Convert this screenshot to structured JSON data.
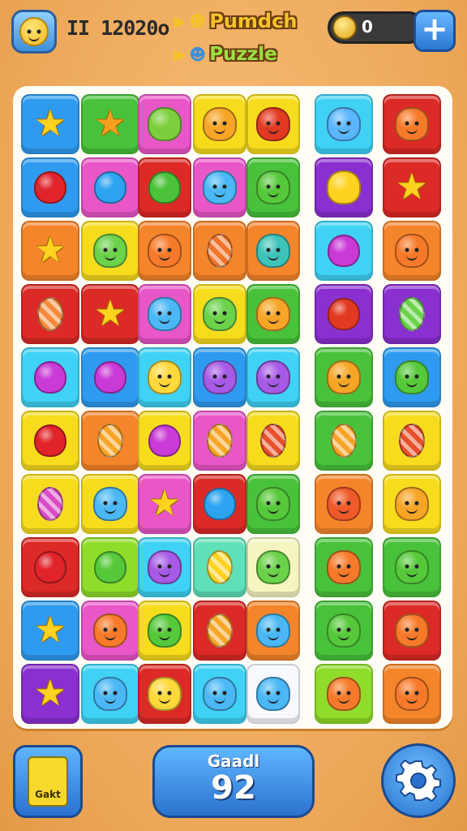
{
  "header": {
    "score": "II 12020o",
    "title_line1": "Pumdch",
    "title_line2": "Puzzle",
    "coins": "0",
    "add_label": "+"
  },
  "footer": {
    "bag_label": "Gakt",
    "goal_label": "Gaadl",
    "goal_value": "92"
  },
  "board": {
    "columns": 7,
    "rows": [
      [
        [
          "blue",
          "star",
          "#ffd21f"
        ],
        [
          "green",
          "star",
          "#f7a020"
        ],
        [
          "pink",
          "blob",
          "#7ccf3c"
        ],
        [
          "yellow",
          "face",
          "#f7a526"
        ],
        [
          "yellow",
          "face",
          "#e23a22"
        ],
        [
          "cyan",
          "face",
          "#5ab6ff"
        ],
        [
          "red",
          "face",
          "#f77a2a"
        ]
      ],
      [
        [
          "blue",
          "heart",
          "#e0242a"
        ],
        [
          "pink",
          "heart",
          "#2ea4f0"
        ],
        [
          "red",
          "heart",
          "#4cc23a"
        ],
        [
          "pink",
          "face",
          "#4bb8f5"
        ],
        [
          "green",
          "face",
          "#56c93a"
        ],
        [
          "purple",
          "blob",
          "#ffd21f"
        ],
        [
          "red",
          "star",
          "#ffd21f"
        ]
      ],
      [
        [
          "orange",
          "star",
          "#ffd21f"
        ],
        [
          "yellow",
          "face",
          "#6bd24a"
        ],
        [
          "orange",
          "face",
          "#f77a2a"
        ],
        [
          "orange",
          "egg",
          "#f0742a"
        ],
        [
          "orange",
          "face",
          "#3ec3b9"
        ],
        [
          "cyan",
          "heart",
          "#c93ad6"
        ],
        [
          "orange",
          "face",
          "#f77a2a"
        ]
      ],
      [
        [
          "red",
          "egg",
          "#f58a3a"
        ],
        [
          "red",
          "star",
          "#ffd21f"
        ],
        [
          "pink",
          "face",
          "#4bb8f5"
        ],
        [
          "yellow",
          "face",
          "#6bd24a"
        ],
        [
          "green",
          "face",
          "#f7a526"
        ],
        [
          "purple",
          "heart",
          "#e23a22"
        ],
        [
          "purple",
          "egg",
          "#6bd24a"
        ]
      ],
      [
        [
          "cyan",
          "heart",
          "#c93ad6"
        ],
        [
          "blue",
          "heart",
          "#c93ad6"
        ],
        [
          "cyan",
          "face",
          "#ffd83a"
        ],
        [
          "blue",
          "face",
          "#a65ae6"
        ],
        [
          "cyan",
          "face",
          "#a65ae6"
        ],
        [
          "green",
          "face",
          "#f7a526"
        ],
        [
          "blue",
          "face",
          "#56c93a"
        ]
      ],
      [
        [
          "yellow",
          "heart",
          "#e0242a"
        ],
        [
          "orange",
          "egg",
          "#f7a526"
        ],
        [
          "yellow",
          "heart",
          "#c93ad6"
        ],
        [
          "pink",
          "egg",
          "#f7a526"
        ],
        [
          "yellow",
          "egg",
          "#e8502a"
        ],
        [
          "green",
          "egg",
          "#f7a526"
        ],
        [
          "yellow",
          "egg",
          "#e8502a"
        ]
      ],
      [
        [
          "yellow",
          "egg",
          "#d94bc4"
        ],
        [
          "yellow",
          "face",
          "#4bb8f5"
        ],
        [
          "pink",
          "star",
          "#ffd21f"
        ],
        [
          "red",
          "heart",
          "#2ea4f0"
        ],
        [
          "green",
          "face",
          "#56c93a"
        ],
        [
          "orange",
          "face",
          "#f05a2a"
        ],
        [
          "yellow",
          "face",
          "#f7a526"
        ]
      ],
      [
        [
          "red",
          "heart",
          "#e0242a"
        ],
        [
          "lime",
          "heart",
          "#56c93a"
        ],
        [
          "cyan",
          "face",
          "#a65ae6"
        ],
        [
          "teal",
          "egg",
          "#ffd21f"
        ],
        [
          "cream",
          "face",
          "#6bd24a"
        ],
        [
          "green",
          "face",
          "#f77a2a"
        ],
        [
          "green",
          "face",
          "#56c93a"
        ]
      ],
      [
        [
          "blue",
          "star",
          "#ffd21f"
        ],
        [
          "pink",
          "face",
          "#f77a2a"
        ],
        [
          "yellow",
          "face",
          "#56c93a"
        ],
        [
          "red",
          "egg",
          "#f7a526"
        ],
        [
          "orange",
          "face",
          "#4bb8f5"
        ],
        [
          "green",
          "face",
          "#56c93a"
        ],
        [
          "red",
          "face",
          "#f77a2a"
        ]
      ],
      [
        [
          "purple",
          "star",
          "#ffd21f"
        ],
        [
          "cyan",
          "face",
          "#4bb8f5"
        ],
        [
          "red",
          "face",
          "#ffd83a"
        ],
        [
          "cyan",
          "face",
          "#4bb8f5"
        ],
        [
          "white",
          "face",
          "#4bb8f5"
        ],
        [
          "lime",
          "face",
          "#f77a2a"
        ],
        [
          "orange",
          "face",
          "#f77a2a"
        ]
      ]
    ]
  },
  "colors": {
    "blue": "#2f9bf0",
    "green": "#48c23a",
    "pink": "#e956c8",
    "yellow": "#f7dc1e",
    "cyan": "#3fd2f5",
    "red": "#dc2a26",
    "orange": "#f5852a",
    "purple": "#8a2fd0",
    "lime": "#8fdc2a",
    "teal": "#5fe0b8",
    "cream": "#f6f4c0",
    "white": "#f7f9ff"
  }
}
